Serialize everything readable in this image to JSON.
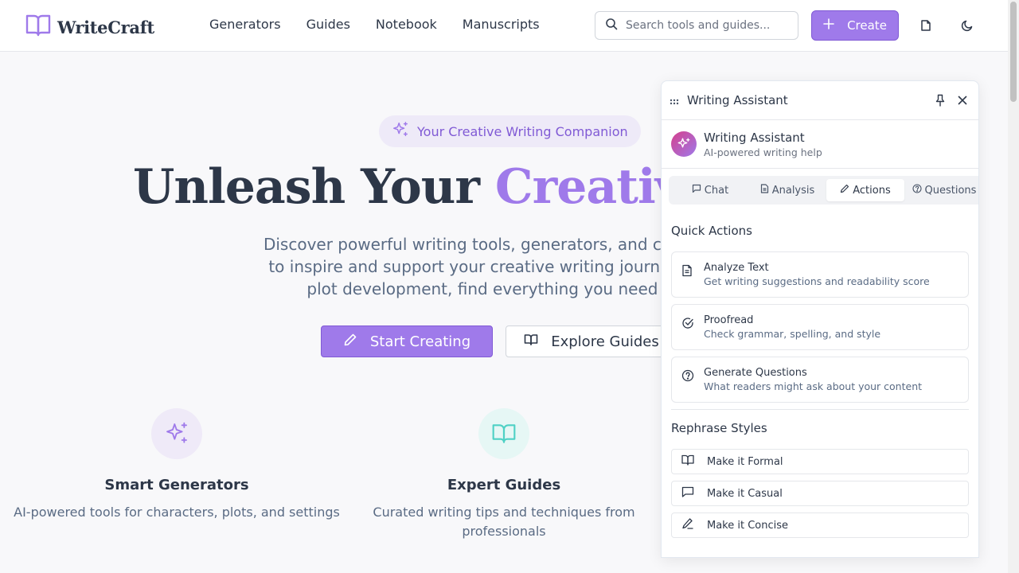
{
  "header": {
    "logo_text": "WriteCraft",
    "nav": [
      "Generators",
      "Guides",
      "Notebook",
      "Manuscripts"
    ],
    "search_placeholder": "Search tools and guides...",
    "create_label": "Create"
  },
  "hero": {
    "badge": "Your Creative Writing Companion",
    "title_main": "Unleash Your ",
    "title_accent": "Creative",
    "description_lines": [
      "Discover powerful writing tools, generators, and comprehensi",
      "to inspire and support your creative writing journey. From ch",
      "plot development, find everything you need in one"
    ],
    "primary_button": "Start Creating",
    "secondary_button": "Explore Guides"
  },
  "features": [
    {
      "title": "Smart Generators",
      "desc": "AI-powered tools for characters, plots, and settings"
    },
    {
      "title": "Expert Guides",
      "desc": "Curated writing tips and techniques from professionals"
    }
  ],
  "assistant": {
    "panel_title": "Writing Assistant",
    "name": "Writing Assistant",
    "subtitle": "AI-powered writing help",
    "tabs": [
      "Chat",
      "Analysis",
      "Actions",
      "Questions"
    ],
    "active_tab": "Actions",
    "quick_actions_title": "Quick Actions",
    "quick_actions": [
      {
        "title": "Analyze Text",
        "desc": "Get writing suggestions and readability score"
      },
      {
        "title": "Proofread",
        "desc": "Check grammar, spelling, and style"
      },
      {
        "title": "Generate Questions",
        "desc": "What readers might ask about your content"
      }
    ],
    "rephrase_title": "Rephrase Styles",
    "rephrase": [
      "Make it Formal",
      "Make it Casual",
      "Make it Concise"
    ]
  },
  "colors": {
    "accent": "#9f7aea",
    "accent_dark": "#805ad5",
    "teal": "#4fd1c5",
    "text": "#2d3748"
  }
}
